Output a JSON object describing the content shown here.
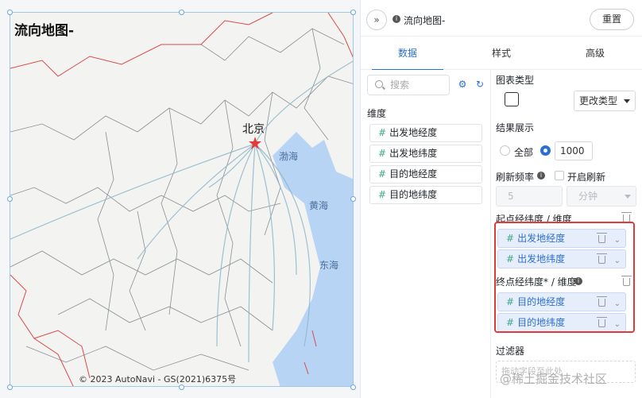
{
  "map": {
    "title": "流向地图-",
    "copyright": "© 2023 AutoNavi - GS(2021)6375号",
    "labels": {
      "beijing": "北京",
      "bohai": "渤海",
      "huanghai": "黄海",
      "donghai": "东海"
    }
  },
  "topbar": {
    "collapse_icon": "»",
    "chart_name": "流向地图-",
    "reset_label": "重置"
  },
  "tabs": [
    "数据",
    "样式",
    "高级"
  ],
  "dims": {
    "search_placeholder": "搜索",
    "title": "维度",
    "fields": [
      "出发地经度",
      "出发地纬度",
      "目的地经度",
      "目的地纬度"
    ]
  },
  "settings": {
    "chart_type_label": "图表类型",
    "change_type_label": "更改类型",
    "result_label": "结果展示",
    "all_label": "全部",
    "limit_value": "1000",
    "refresh_label": "刷新频率",
    "auto_refresh_label": "开启刷新",
    "refresh_value": "5",
    "refresh_unit": "分钟",
    "start_label": "起点经纬度 / 维度",
    "start_fields": [
      "出发地经度",
      "出发地纬度"
    ],
    "end_label": "终点经纬度* / 维度",
    "end_fields": [
      "目的地经度",
      "目的地纬度"
    ],
    "filter_label": "过滤器",
    "filter_placeholder": "拖动字段至此处"
  },
  "watermark": "@稀土掘金技术社区",
  "colors": {
    "accent": "#2b6ed2",
    "highlight": "#e03a3a",
    "field_hash": "#3fa888"
  }
}
